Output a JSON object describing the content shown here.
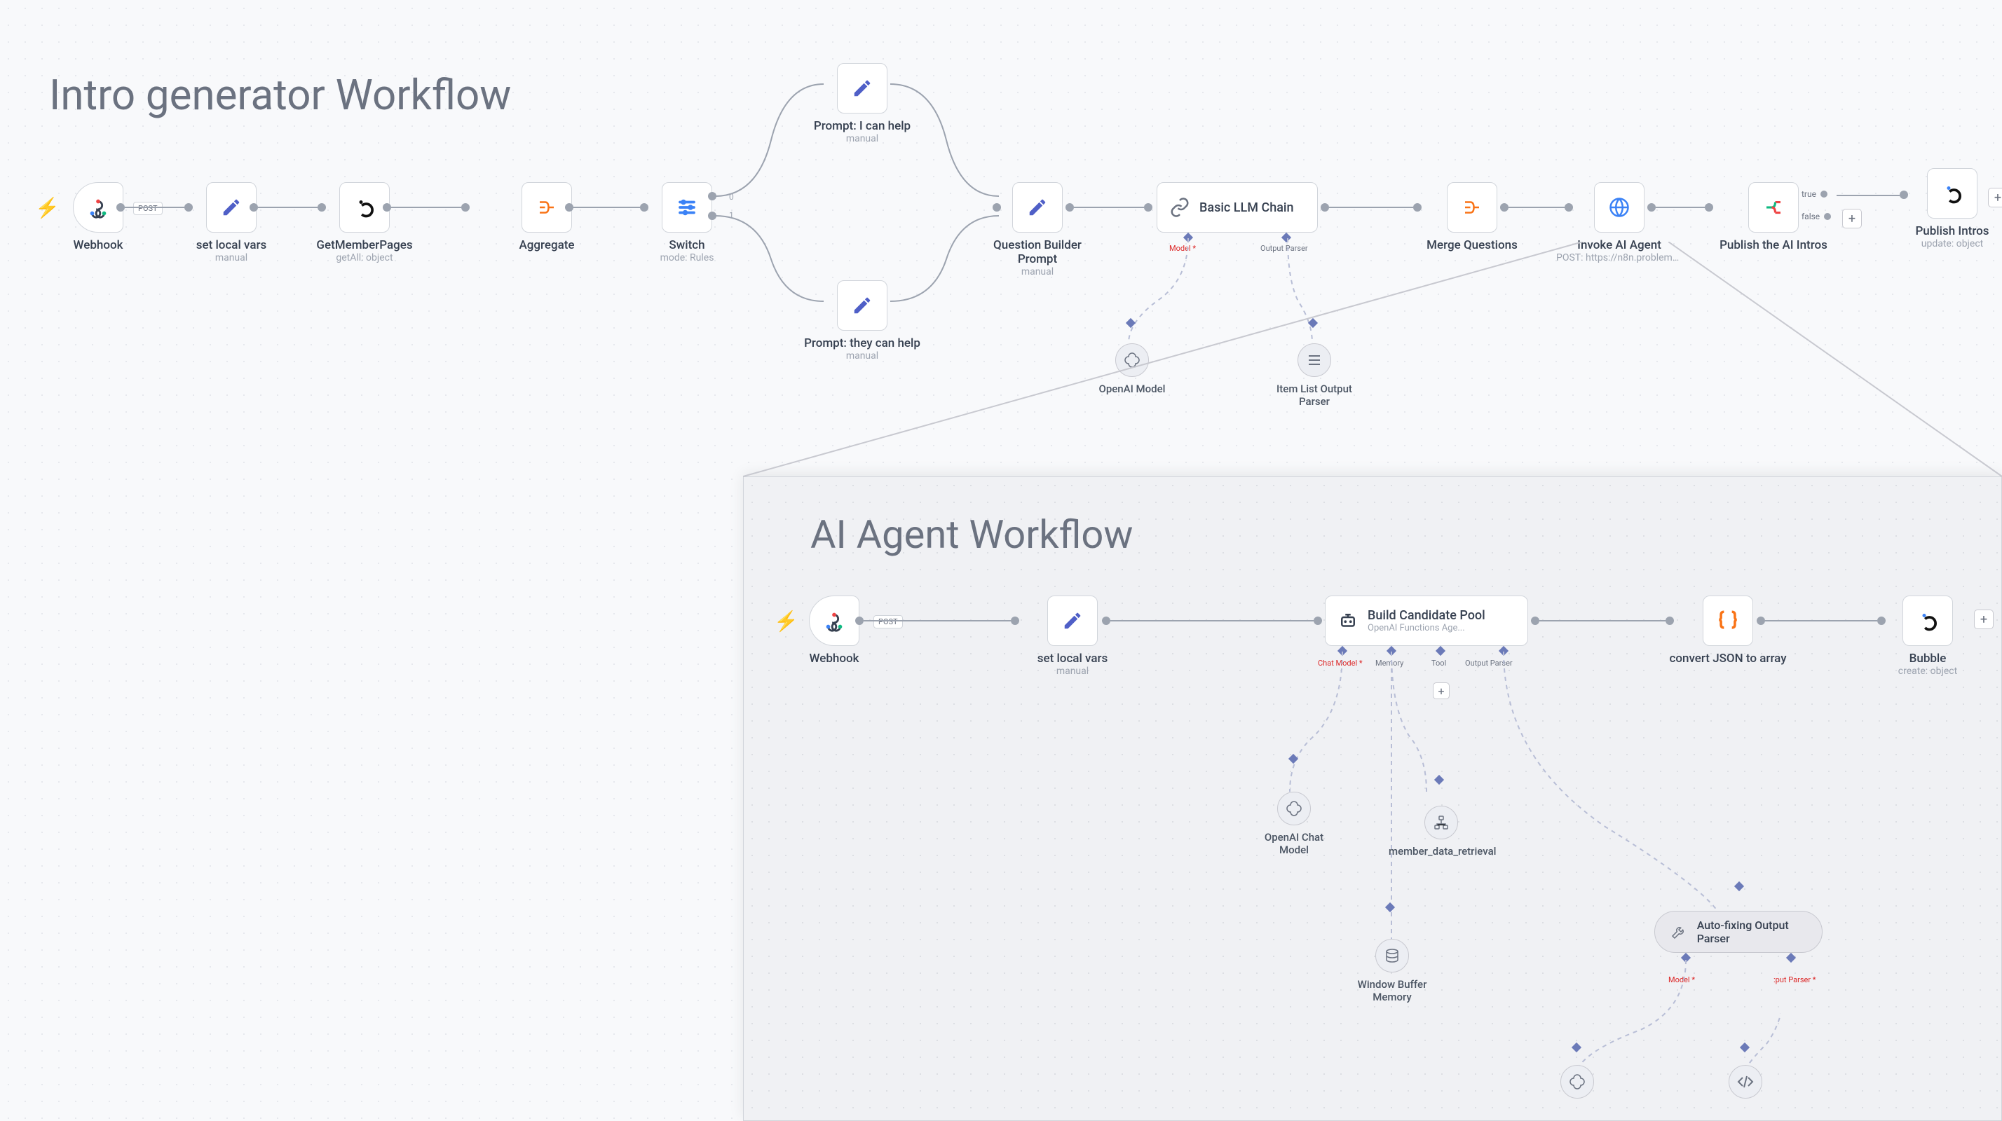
{
  "workflow1": {
    "title": "Intro generator Workflow",
    "nodes": {
      "webhook": {
        "label": "Webhook",
        "method": "POST"
      },
      "setvars": {
        "label": "set local vars",
        "sub": "manual"
      },
      "getmember": {
        "label": "GetMemberPages",
        "sub": "getAll: object"
      },
      "aggregate": {
        "label": "Aggregate"
      },
      "switch": {
        "label": "Switch",
        "sub": "mode: Rules",
        "port0": "0",
        "port1": "1"
      },
      "promptHelp": {
        "label": "Prompt: I can help",
        "sub": "manual"
      },
      "promptThey": {
        "label": "Prompt: they can help",
        "sub": "manual"
      },
      "questionBuilder": {
        "label": "Question Builder Prompt",
        "sub": "manual"
      },
      "llmChain": {
        "label": "Basic LLM Chain",
        "modelPort": "Model *",
        "parserPort": "Output Parser"
      },
      "mergeQ": {
        "label": "Merge Questions"
      },
      "invokeAgent": {
        "label": "Invoke AI Agent",
        "sub": "POST: https://n8n.problemat..."
      },
      "publishIntros": {
        "label": "Publish the AI Intros",
        "tf_true": "true",
        "tf_false": "false"
      },
      "publishBubble": {
        "label": "Publish Intros",
        "sub": "update: object"
      },
      "openaiModel": {
        "label": "OpenAI Model"
      },
      "itemParser": {
        "label": "Item List Output Parser"
      }
    }
  },
  "workflow2": {
    "title": "AI Agent Workflow",
    "nodes": {
      "webhook": {
        "label": "Webhook",
        "method": "POST"
      },
      "setvars": {
        "label": "set local vars",
        "sub": "manual"
      },
      "buildPool": {
        "label": "Build Candidate Pool",
        "sub": "OpenAI Functions Age...",
        "p_chat": "Chat Model *",
        "p_mem": "Memory",
        "p_tool": "Tool",
        "p_out": "Output Parser"
      },
      "convertJson": {
        "label": "convert JSON to array"
      },
      "bubble": {
        "label": "Bubble",
        "sub": "create: object"
      },
      "openaiChat": {
        "label": "OpenAI Chat Model"
      },
      "memberData": {
        "label": "member_data_retrieval"
      },
      "windowBuffer": {
        "label": "Window Buffer Memory"
      },
      "autofix": {
        "label": "Auto-fixing Output Parser",
        "modelPort": "Model *",
        "parserPort": ":put Parser *"
      }
    }
  }
}
